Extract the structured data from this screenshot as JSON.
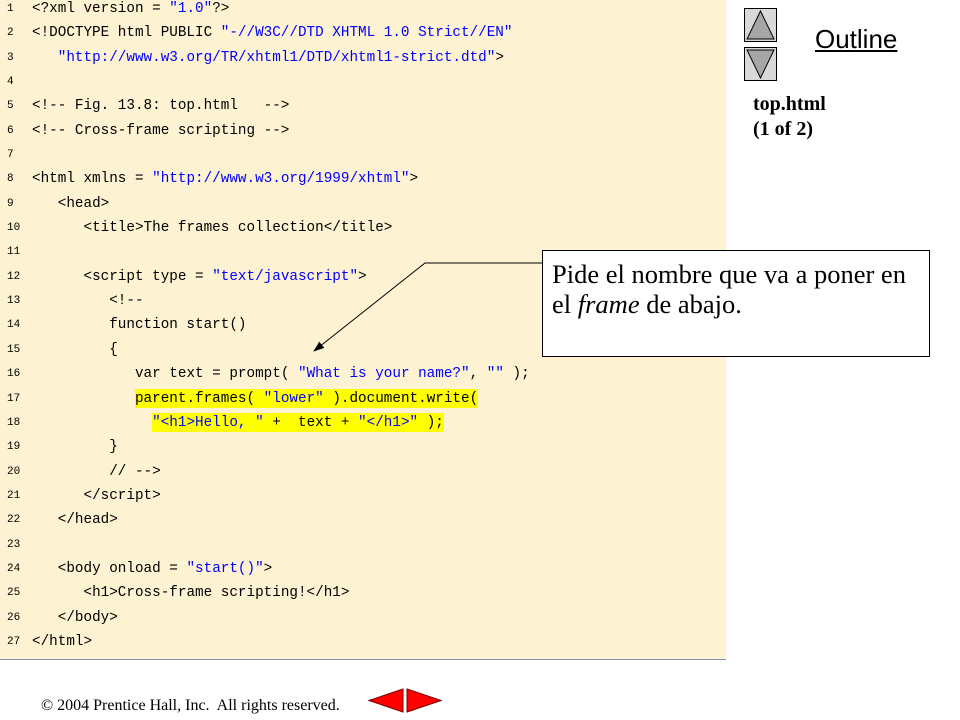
{
  "colors": {
    "code_background": "#FDF2D2",
    "code_text": "#000000",
    "string_text": "#0000FF",
    "highlight": "#FFFF00",
    "nav_arrow": "#FF0000",
    "scroll_button": "#D9D9D9",
    "scroll_triangle": "#A6A6A6"
  },
  "icons": {
    "scroll_up": "up-triangle-icon",
    "scroll_down": "down-triangle-icon",
    "previous_slide": "left-arrow-icon",
    "next_slide": "right-arrow-icon"
  },
  "sidebar": {
    "outline_label": "Outline",
    "file_name": "top.html",
    "file_part": "(1 of 2)"
  },
  "callout": {
    "line1": "Pide el nombre que va a poner en",
    "line2_start": "el ",
    "line2_italic": "frame",
    "line2_end": " de abajo."
  },
  "footer": {
    "copyright": "© 2004 Prentice Hall, Inc.  All rights reserved."
  },
  "code": {
    "lines": [
      {
        "n": "1",
        "tokens": [
          {
            "text": "<?xml version = "
          },
          {
            "text": "\"1.0\"",
            "string_literal": true
          },
          {
            "text": "?>"
          }
        ]
      },
      {
        "n": "2",
        "tokens": [
          {
            "text": "<!DOCTYPE html PUBLIC "
          },
          {
            "text": "\"-//W3C//DTD XHTML 1.0 Strict//EN\"",
            "string_literal": true
          }
        ]
      },
      {
        "n": "3",
        "indent": "   ",
        "tokens": [
          {
            "text": "\"http://www.w3.org/TR/xhtml1/DTD/xhtml1-strict.dtd\"",
            "string_literal": true
          },
          {
            "text": ">"
          }
        ]
      },
      {
        "n": "4"
      },
      {
        "n": "5",
        "tokens": [
          {
            "text": "<!-- Fig. 13.8: top.html   -->"
          }
        ]
      },
      {
        "n": "6",
        "tokens": [
          {
            "text": "<!-- Cross-frame scripting -->"
          }
        ]
      },
      {
        "n": "7"
      },
      {
        "n": "8",
        "tokens": [
          {
            "text": "<html xmlns = "
          },
          {
            "text": "\"http://www.w3.org/1999/xhtml\"",
            "string_literal": true
          },
          {
            "text": ">"
          }
        ]
      },
      {
        "n": "9",
        "indent": "   ",
        "tokens": [
          {
            "text": "<head>"
          }
        ]
      },
      {
        "n": "10",
        "indent": "      ",
        "tokens": [
          {
            "text": "<title>The frames collection</title>"
          }
        ]
      },
      {
        "n": "11"
      },
      {
        "n": "12",
        "indent": "      ",
        "tokens": [
          {
            "text": "<script type = "
          },
          {
            "text": "\"text/javascript\"",
            "string_literal": true
          },
          {
            "text": ">"
          }
        ]
      },
      {
        "n": "13",
        "indent": "         ",
        "tokens": [
          {
            "text": "<!--"
          }
        ]
      },
      {
        "n": "14",
        "indent": "         ",
        "tokens": [
          {
            "text": "function start()"
          }
        ]
      },
      {
        "n": "15",
        "indent": "         ",
        "tokens": [
          {
            "text": "{"
          }
        ]
      },
      {
        "n": "16",
        "indent": "            ",
        "tokens": [
          {
            "text": "var text = prompt( "
          },
          {
            "text": "\"What is your name?\"",
            "string_literal": true
          },
          {
            "text": ", "
          },
          {
            "text": "\"\"",
            "string_literal": true
          },
          {
            "text": " );"
          }
        ]
      },
      {
        "n": "17",
        "highlight": true,
        "indent": "            ",
        "tokens": [
          {
            "text": "parent.frames( "
          },
          {
            "text": "\"lower\"",
            "string_literal": true
          },
          {
            "text": " ).document.write("
          }
        ]
      },
      {
        "n": "18",
        "highlight": true,
        "indent": "              ",
        "tokens": [
          {
            "text": "\"<h1>Hello, \"",
            "string_literal": true
          },
          {
            "text": " +  text + "
          },
          {
            "text": "\"</h1>\"",
            "string_literal": true
          },
          {
            "text": " );"
          }
        ]
      },
      {
        "n": "19",
        "indent": "         ",
        "tokens": [
          {
            "text": "}"
          }
        ]
      },
      {
        "n": "20",
        "indent": "         ",
        "tokens": [
          {
            "text": "// -->"
          }
        ]
      },
      {
        "n": "21",
        "indent": "      ",
        "tokens": [
          {
            "text": "</script>"
          }
        ]
      },
      {
        "n": "22",
        "indent": "   ",
        "tokens": [
          {
            "text": "</head>"
          }
        ]
      },
      {
        "n": "23"
      },
      {
        "n": "24",
        "indent": "   ",
        "tokens": [
          {
            "text": "<body onload = "
          },
          {
            "text": "\"start()\"",
            "string_literal": true
          },
          {
            "text": ">"
          }
        ]
      },
      {
        "n": "25",
        "indent": "      ",
        "tokens": [
          {
            "text": "<h1>Cross-frame scripting!</h1>"
          }
        ]
      },
      {
        "n": "26",
        "indent": "   ",
        "tokens": [
          {
            "text": "</body>"
          }
        ]
      },
      {
        "n": "27",
        "tokens": [
          {
            "text": "</html>"
          }
        ]
      }
    ]
  }
}
